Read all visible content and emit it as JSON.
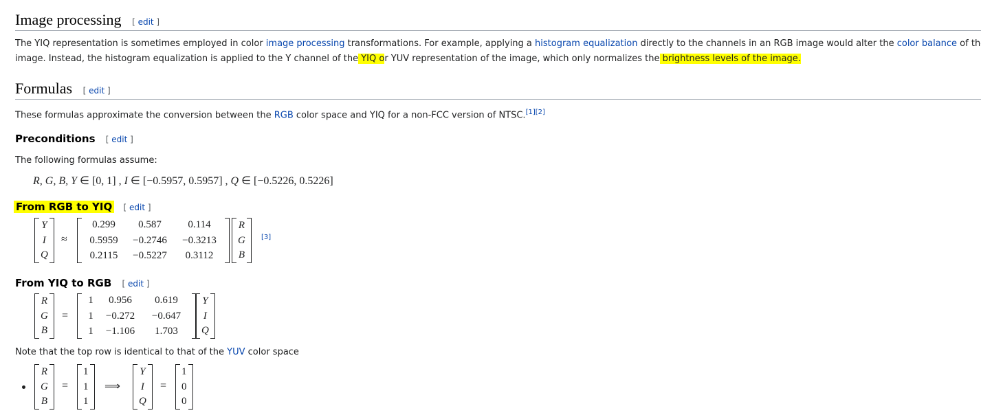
{
  "section_image": {
    "title": "Image processing",
    "edit": "edit",
    "p1_a": "The YIQ representation is sometimes employed in color ",
    "p1_link1": "image processing",
    "p1_b": " transformations. For example, applying a ",
    "p1_link2": "histogram equalization",
    "p1_c": " directly to the channels in an RGB image would alter the ",
    "p1_link3": "color balance",
    "p1_d": " of the",
    "p2_a": "image. Instead, the histogram equalization is applied to the Y channel of the",
    "p2_hl1": " YIQ o",
    "p2_b": "r YUV representation of the image, which only normalizes the",
    "p2_hl2": " brightness levels of the image."
  },
  "section_formulas": {
    "title": "Formulas",
    "edit": "edit",
    "p_a": "These formulas approximate the conversion between the ",
    "p_link": "RGB",
    "p_b": " color space and YIQ for a non-FCC version of NTSC.",
    "refs": "[1][2]"
  },
  "preconditions": {
    "title": "Preconditions",
    "edit": "edit",
    "text": "The following formulas assume:",
    "formula_a": "R, G, B, Y",
    "formula_b": " ∈ [0, 1] ,   ",
    "formula_c": "I",
    "formula_d": " ∈ [−0.5957, 0.5957] ,   ",
    "formula_e": "Q",
    "formula_f": " ∈ [−0.5226, 0.5226]"
  },
  "rgb_to_yiq": {
    "title": "From RGB to YIQ",
    "edit": "edit",
    "lhs": [
      "Y",
      "I",
      "Q"
    ],
    "op": "≈",
    "matrix": [
      [
        "0.299",
        "0.587",
        "0.114"
      ],
      [
        "0.5959",
        "−0.2746",
        "−0.3213"
      ],
      [
        "0.2115",
        "−0.5227",
        "0.3112"
      ]
    ],
    "rhs": [
      "R",
      "G",
      "B"
    ],
    "ref": "[3]"
  },
  "yiq_to_rgb": {
    "title": "From YIQ to RGB",
    "edit": "edit",
    "lhs": [
      "R",
      "G",
      "B"
    ],
    "op": "=",
    "matrix": [
      [
        "1",
        "0.956",
        "0.619"
      ],
      [
        "1",
        "−0.272",
        "−0.647"
      ],
      [
        "1",
        "−1.106",
        "1.703"
      ]
    ],
    "rhs": [
      "Y",
      "I",
      "Q"
    ]
  },
  "note": {
    "text_a": "Note that the top row is identical to that of the ",
    "link": "YUV",
    "text_b": " color space",
    "m1": [
      "R",
      "G",
      "B"
    ],
    "eq1": "=",
    "m2": [
      "1",
      "1",
      "1"
    ],
    "implies": "⟹",
    "m3": [
      "Y",
      "I",
      "Q"
    ],
    "eq2": "=",
    "m4": [
      "1",
      "0",
      "0"
    ]
  },
  "colors": {
    "link": "#0645ad",
    "highlight": "#ffff00",
    "text": "#202122"
  }
}
